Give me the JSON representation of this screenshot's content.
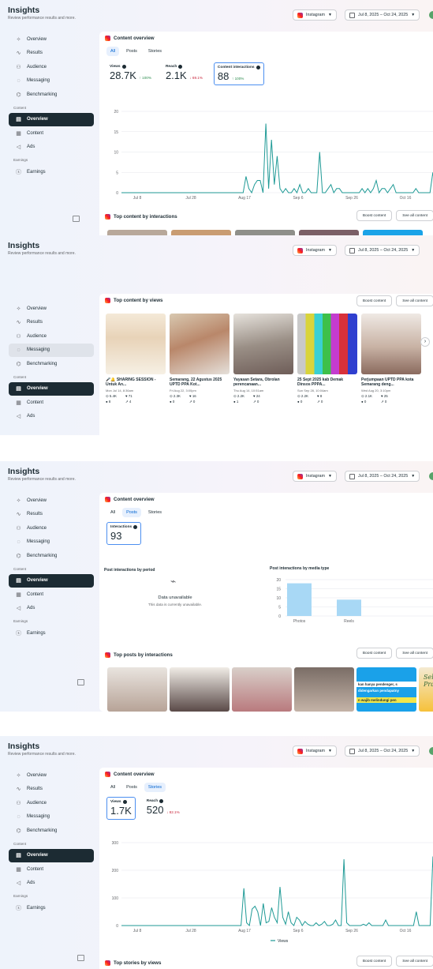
{
  "app": {
    "title": "Insights",
    "subtitle": "Review performance results and more.",
    "platform": "Instagram",
    "date_range": "Jul 8, 2025 – Oct 24, 2025"
  },
  "sidebar": {
    "items": [
      {
        "label": "Overview",
        "icon": "sparkle-icon"
      },
      {
        "label": "Results",
        "icon": "trend-icon"
      },
      {
        "label": "Audience",
        "icon": "people-icon"
      },
      {
        "label": "Messaging",
        "icon": "chat-icon"
      },
      {
        "label": "Benchmarking",
        "icon": "benchmark-icon"
      }
    ],
    "content_section": "Content",
    "content_items": [
      {
        "label": "Overview",
        "icon": "overview-icon"
      },
      {
        "label": "Content",
        "icon": "grid-icon"
      },
      {
        "label": "Ads",
        "icon": "megaphone-icon"
      }
    ],
    "earnings_section": "Earnings",
    "earnings_items": [
      {
        "label": "Earnings",
        "icon": "dollar-icon"
      }
    ]
  },
  "tabs": [
    "All",
    "Posts",
    "Stories"
  ],
  "buttons": {
    "boost": "Boost content",
    "see_all": "See all content"
  },
  "panel1": {
    "title": "Content overview",
    "metrics": [
      {
        "label": "Views",
        "value": "28.7K",
        "change": "↑ 100%"
      },
      {
        "label": "Reach",
        "value": "2.1K",
        "change": "↓ 69.1%"
      },
      {
        "label": "Content interactions",
        "value": "88",
        "change": "↑ 100%"
      }
    ],
    "section": "Top content by interactions"
  },
  "panel2": {
    "title": "Top content by views",
    "cards": [
      {
        "title": "🎤🔔 SHARING SESSION - Untuk An...",
        "date": "Mon Jul 14, 8:36am",
        "views": "5.4K",
        "likes": "71",
        "comments": "8",
        "shares": "4"
      },
      {
        "title": "Semarang, 22 Agustus 2025 UPTD PPA Kot...",
        "date": "Fri Aug 22, 3:00pm",
        "views": "2.3K",
        "likes": "16",
        "comments": "0",
        "shares": "0"
      },
      {
        "title": "Yayasan Setara, Obrolan perencanaan...",
        "date": "Thu Aug 14, 10:51am",
        "views": "2.2K",
        "likes": "24",
        "comments": "1",
        "shares": "0"
      },
      {
        "title": "25 Sept 2025 kab Demak Dinsos PPPA...",
        "date": "Sun Sep 28, 10:04am",
        "views": "2.2K",
        "likes": "8",
        "comments": "0",
        "shares": "0"
      },
      {
        "title": "Perjumpaan UPTD PPA kota Semarang deng...",
        "date": "Wed Aug 20, 3:10pm",
        "views": "2.1K",
        "likes": "25",
        "comments": "0",
        "shares": "0"
      }
    ]
  },
  "panel3": {
    "title": "Content overview",
    "metric_label": "Interactions",
    "metric_value": "93",
    "period_title": "Post interactions by period",
    "unavailable_title": "Data unavailable",
    "unavailable_text": "This data is currently unavailable.",
    "media_title": "Post interactions by media type",
    "section": "Top posts by interactions",
    "banner_text": [
      "kan hanya pendenger, s",
      "didengarkan pendapatny",
      "n wajib melindungi pen"
    ],
    "pramuka_text": "Selamat Hari Pramuka"
  },
  "panel4": {
    "title": "Content overview",
    "metrics": [
      {
        "label": "Views",
        "value": "1.7K"
      },
      {
        "label": "Reach",
        "value": "520",
        "change": "↓ 82.1%"
      }
    ],
    "legend": "Views",
    "section": "Top stories by views"
  },
  "chart_data": [
    {
      "type": "line",
      "title": "",
      "x_ticks": [
        "Jul 8",
        "Jul 28",
        "Aug 17",
        "Sep 6",
        "Sep 26",
        "Oct 16"
      ],
      "ylim": [
        0,
        20
      ],
      "y_ticks": [
        0,
        5,
        10,
        15,
        20
      ],
      "grid": true,
      "series": [
        {
          "values": [
            0,
            0,
            0,
            0,
            0,
            0,
            0,
            0,
            0,
            0,
            0,
            0,
            0,
            0,
            0,
            0,
            0,
            0,
            0,
            0,
            0,
            0,
            0,
            0,
            0,
            0,
            0,
            0,
            0,
            0,
            0,
            0,
            0,
            0,
            0,
            0,
            0,
            0,
            0,
            0,
            0,
            0,
            0,
            0,
            4,
            1,
            0,
            2,
            3,
            3,
            0,
            17,
            1,
            13,
            2,
            9,
            1,
            0,
            1,
            0,
            0,
            1,
            0,
            2,
            0,
            0,
            1,
            0,
            0,
            0,
            10,
            0,
            0,
            1,
            2,
            0,
            1,
            1,
            0,
            0,
            0,
            0,
            0,
            0,
            0,
            1,
            0,
            1,
            0,
            1,
            3,
            0,
            1,
            1,
            0,
            1,
            2,
            0,
            0,
            0,
            0,
            0,
            0,
            0,
            1,
            0,
            0,
            0,
            0,
            0,
            5,
            0,
            1
          ]
        }
      ]
    },
    {
      "type": "bar",
      "title": "Post interactions by media type",
      "categories": [
        "Photos",
        "Reels"
      ],
      "values": [
        18,
        9
      ],
      "ylim": [
        0,
        20
      ],
      "y_ticks": [
        0,
        5,
        10,
        15,
        20
      ]
    },
    {
      "type": "line",
      "title": "",
      "x_ticks": [
        "Jul 8",
        "Jul 28",
        "Aug 17",
        "Sep 6",
        "Sep 26",
        "Oct 16"
      ],
      "ylim": [
        0,
        300
      ],
      "y_ticks": [
        0,
        100,
        200,
        300
      ],
      "legend": "Views",
      "grid": true,
      "series": [
        {
          "name": "Views",
          "values": [
            0,
            0,
            0,
            0,
            0,
            0,
            0,
            0,
            0,
            0,
            0,
            0,
            0,
            0,
            0,
            0,
            0,
            0,
            0,
            0,
            0,
            0,
            0,
            0,
            0,
            0,
            0,
            0,
            0,
            0,
            0,
            0,
            0,
            0,
            0,
            0,
            0,
            0,
            0,
            0,
            0,
            0,
            0,
            0,
            135,
            10,
            0,
            60,
            70,
            50,
            0,
            80,
            10,
            15,
            65,
            30,
            10,
            140,
            30,
            5,
            50,
            10,
            0,
            30,
            20,
            0,
            15,
            5,
            0,
            0,
            10,
            0,
            5,
            15,
            0,
            0,
            5,
            20,
            0,
            0,
            240,
            10,
            0,
            0,
            0,
            0,
            0,
            5,
            0,
            10,
            0,
            0,
            0,
            0,
            0,
            20,
            0,
            0,
            0,
            0,
            0,
            0,
            0,
            0,
            0,
            0,
            50,
            0,
            0,
            0,
            0,
            0,
            250,
            0,
            20
          ]
        }
      ]
    }
  ]
}
